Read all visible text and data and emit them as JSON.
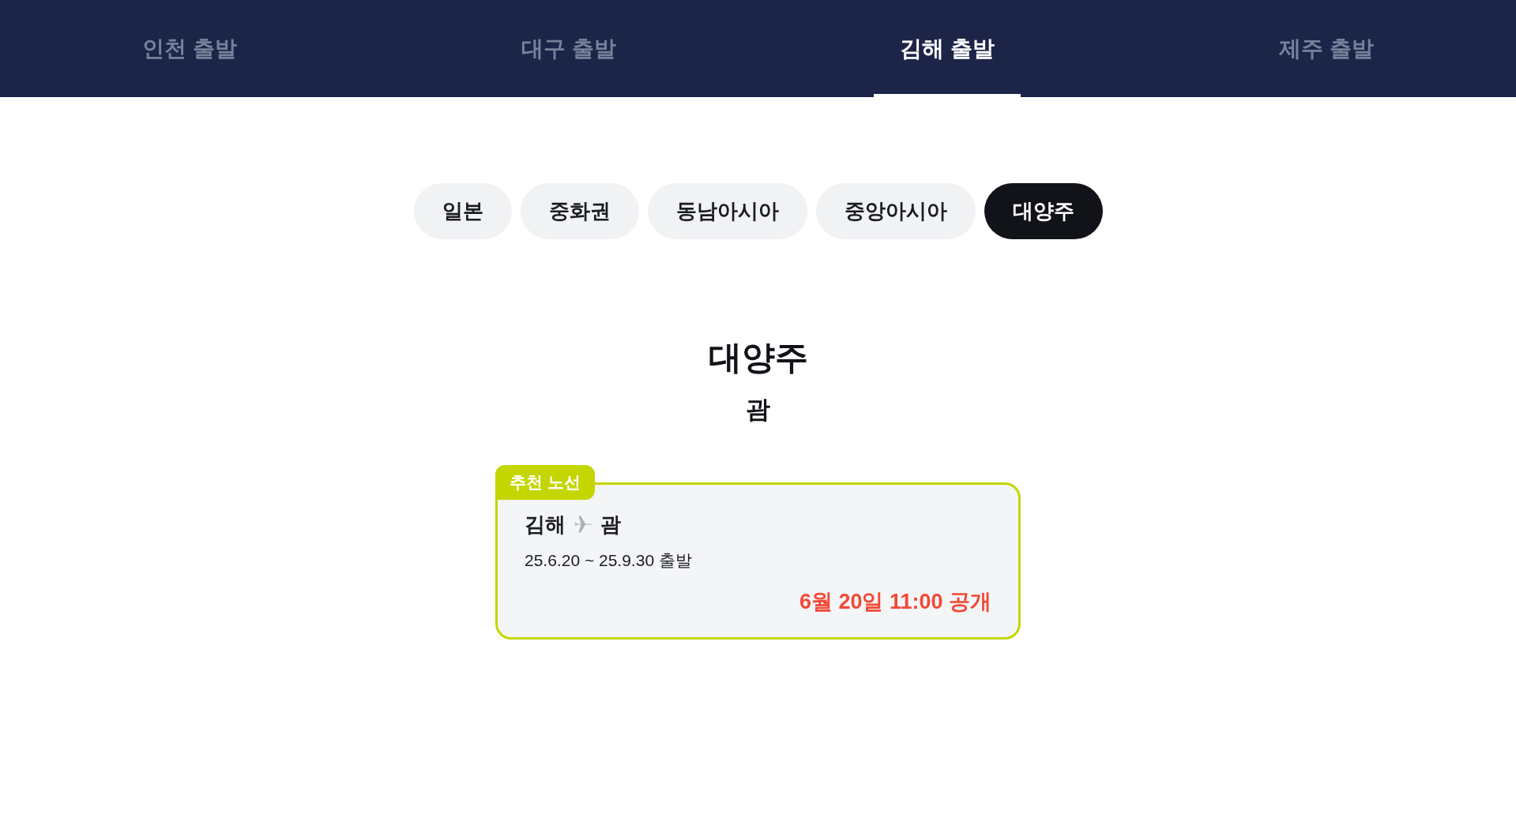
{
  "departure_tabs": [
    {
      "label": "인천 출발",
      "selected": false
    },
    {
      "label": "대구 출발",
      "selected": false
    },
    {
      "label": "김해 출발",
      "selected": true
    },
    {
      "label": "제주 출발",
      "selected": false
    }
  ],
  "region_chips": [
    {
      "label": "일본",
      "selected": false
    },
    {
      "label": "중화권",
      "selected": false
    },
    {
      "label": "동남아시아",
      "selected": false
    },
    {
      "label": "중앙아시아",
      "selected": false
    },
    {
      "label": "대양주",
      "selected": true
    }
  ],
  "section": {
    "title": "대양주",
    "subtitle": "괌"
  },
  "routes": [
    {
      "badge": "추천 노선",
      "origin": "김해",
      "destination": "괌",
      "period": "25.6.20 ~ 25.9.30 출발",
      "open_time": "6월 20일 11:00 공개"
    }
  ]
}
